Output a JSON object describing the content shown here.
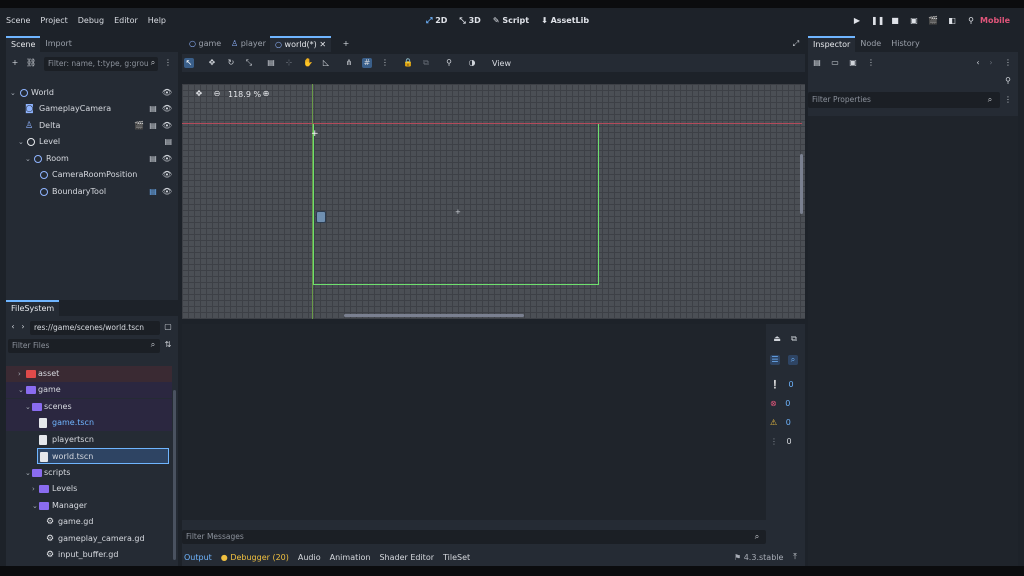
{
  "menu": [
    "Scene",
    "Project",
    "Debug",
    "Editor",
    "Help"
  ],
  "modes": [
    {
      "label": "2D",
      "icon": "2d-icon",
      "active": true
    },
    {
      "label": "3D",
      "icon": "3d-icon",
      "active": false
    },
    {
      "label": "Script",
      "icon": "script-icon",
      "active": false
    },
    {
      "label": "AssetLib",
      "icon": "assetlib-icon",
      "active": false
    }
  ],
  "renderer": "Mobile",
  "scene_dock": {
    "tabs": [
      "Scene",
      "Import"
    ],
    "filter_placeholder": "Filter: name, t:type, g:grou",
    "tree": [
      {
        "label": "World",
        "indent": 0
      },
      {
        "label": "GameplayCamera",
        "indent": 1
      },
      {
        "label": "Delta",
        "indent": 1
      },
      {
        "label": "Level",
        "indent": 1
      },
      {
        "label": "Room",
        "indent": 2
      },
      {
        "label": "CameraRoomPosition",
        "indent": 3
      },
      {
        "label": "BoundaryTool",
        "indent": 3
      }
    ]
  },
  "filesystem": {
    "tab": "FileSystem",
    "path": "res://game/scenes/world.tscn",
    "filter_placeholder": "Filter Files",
    "items": [
      {
        "label": "asset"
      },
      {
        "label": "game"
      },
      {
        "label": "scenes"
      },
      {
        "label": "game.tscn"
      },
      {
        "label": "playertscn"
      },
      {
        "label": "world.tscn"
      },
      {
        "label": "scripts"
      },
      {
        "label": "Levels"
      },
      {
        "label": "Manager"
      },
      {
        "label": "game.gd"
      },
      {
        "label": "gameplay_camera.gd"
      },
      {
        "label": "input_buffer.gd"
      }
    ]
  },
  "editor_tabs": [
    "game",
    "player",
    "world(*)"
  ],
  "toolbar": {
    "view_label": "View"
  },
  "zoom": "118.9 %",
  "bottom": {
    "filter_placeholder": "Filter Messages",
    "tabs": [
      "Output",
      "Debugger (20)",
      "Audio",
      "Animation",
      "Shader Editor",
      "TileSet"
    ],
    "version": "4.3.stable",
    "counts": [
      "0",
      "0",
      "0",
      "0"
    ]
  },
  "inspector": {
    "tabs": [
      "Inspector",
      "Node",
      "History"
    ],
    "filter_placeholder": "Filter Properties"
  },
  "colors": {
    "accent": "#6fb5ff",
    "boundary": "#6ee06e",
    "folder": "#8a6cf0",
    "folder_red": "#e04a4a",
    "renderer": "#e0557a"
  }
}
